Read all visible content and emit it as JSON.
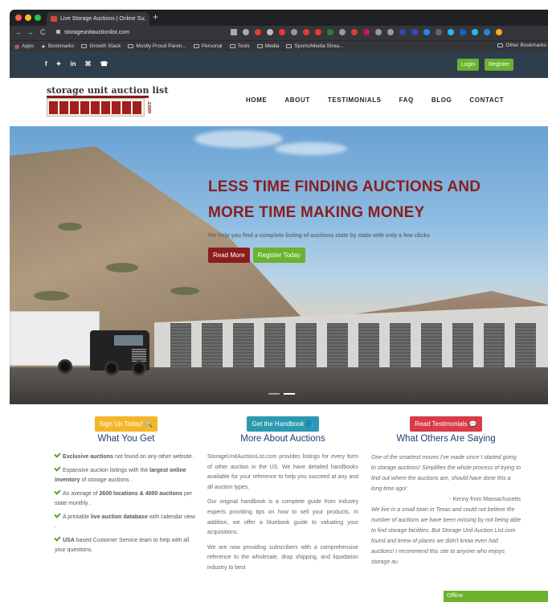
{
  "browser": {
    "tab_title": "Live Storage Auctions | Online S...",
    "url": "storageunitauctionlist.com",
    "bookmarks": [
      "Apps",
      "Bookmarks",
      "Growth Stack",
      "Mostly Proud Paren...",
      "Personal",
      "Tools",
      "Media",
      "Sports/Media Strea..."
    ],
    "other_bookmarks": "Other Bookmarks"
  },
  "topbar": {
    "social": [
      "f",
      "✦",
      "in",
      "⌘",
      "☎"
    ],
    "login_label": "Login",
    "register_label": "Register",
    "accent": "#6bb22f"
  },
  "header": {
    "logo_text": "storage unit auction list",
    "logo_suffix": ".com",
    "menu": [
      "HOME",
      "ABOUT",
      "TESTIMONIALS",
      "FAQ",
      "BLOG",
      "CONTACT"
    ]
  },
  "hero": {
    "title_line1": "LESS TIME FINDING AUCTIONS AND",
    "title_line2": "MORE TIME MAKING MONEY",
    "subtitle": "We help you find a complete listing of auctions state by state with only a few clicks",
    "read_more_label": "Read More",
    "register_today_label": "Register Today",
    "title_color": "#8b1d1d"
  },
  "col1": {
    "button_label": "Sign Up Today! 🔍",
    "heading": "What You Get",
    "items": [
      {
        "b": "Exclusive auctions",
        "t": " not found on any other website ."
      },
      {
        "pre": "Expansive auction listings with the ",
        "b": "largest online inventory",
        "t": " of storage auctions ."
      },
      {
        "pre": "An average of ",
        "b": "2600 locations & 4000 auctions",
        "t": " per state monthly ."
      },
      {
        "pre": "A printable ",
        "b": "live auction database",
        "t": " with calendar view ."
      },
      {
        "b": "USA",
        "t": " based Customer Service team to help with all your questions."
      }
    ]
  },
  "col2": {
    "button_label": "Get the Handbook 📘",
    "heading": "More About Auctions",
    "paragraphs": [
      "StorageUnitAuctionList.com provides listings for every form of other auction in the US. We have detailed handbooks available for your reference to help you succeed at any and all auction types.",
      "Our original handbook is a complete guide from industry experts providing tips on how to sell your products. In addition, we offer a bluebook guide to valuating your acquisitions.",
      "We are now providing subscribers with a comprehensive reference to the wholesale, drop shipping, and liquidation industry to best"
    ]
  },
  "col3": {
    "button_label": "Read Testimonials 💬",
    "heading": "What Others Are Saying",
    "quote1": "One of the smartest moves I've made since I started going to storage auctions! Simplifies the whole process of trying to find out where the auctions are, should have done this a long time ago!",
    "author1": "- Kenny from Massachusetts",
    "quote2": "We live in a small town in Texas and could not believe the number of auctions we have been missing by not being able to find storage facilities. But Storage Unit Auction List.com found and knew of places we didn't know even had auctions! I recommend this site to anyone who enjoys storage au"
  },
  "chat": {
    "status": "Offline"
  }
}
